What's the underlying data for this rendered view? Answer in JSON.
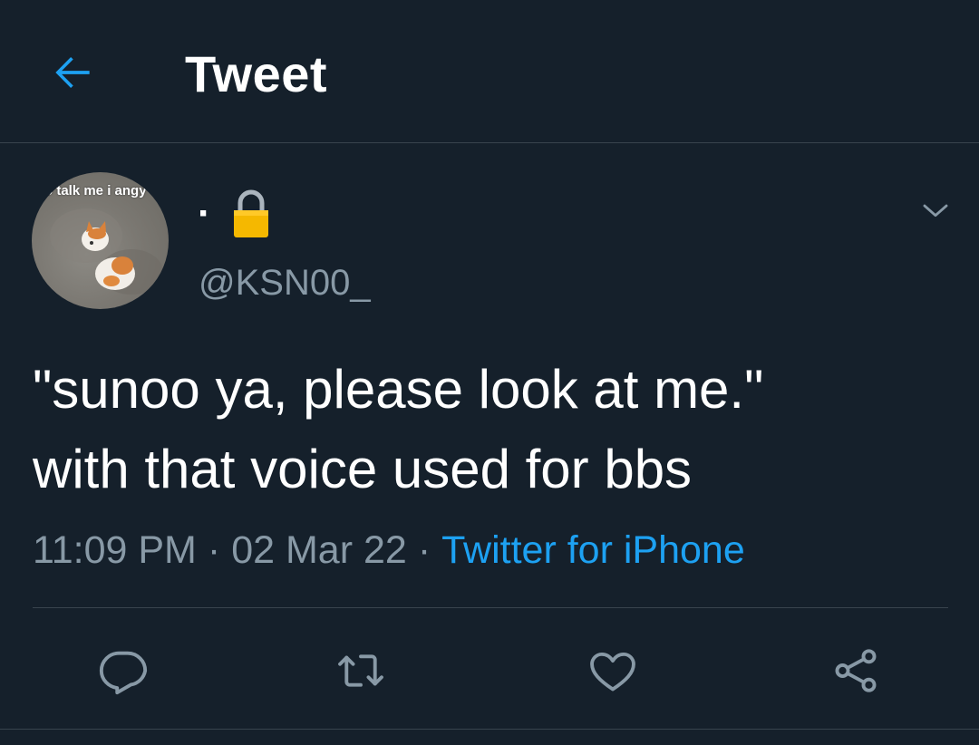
{
  "header": {
    "title": "Tweet",
    "back_icon": "arrow-left-icon"
  },
  "author": {
    "display_name": "·",
    "protected_icon": "lock-icon",
    "handle": "@KSN00_",
    "avatar_caption": "o talk me i angy"
  },
  "tweet": {
    "text_lines": [
      "\"sunoo ya, please look at me.\"",
      "with that voice used for bbs"
    ]
  },
  "meta": {
    "time": "11:09 PM",
    "separator": "·",
    "date": "02 Mar 22",
    "source": "Twitter for iPhone"
  },
  "actions": {
    "reply_icon": "reply-icon",
    "retweet_icon": "retweet-icon",
    "like_icon": "heart-icon",
    "share_icon": "share-icon"
  },
  "colors": {
    "background": "#15202b",
    "accent": "#1da1f2",
    "secondary_text": "#8899a6",
    "divider": "#38444d",
    "lock": "#f5b800"
  }
}
